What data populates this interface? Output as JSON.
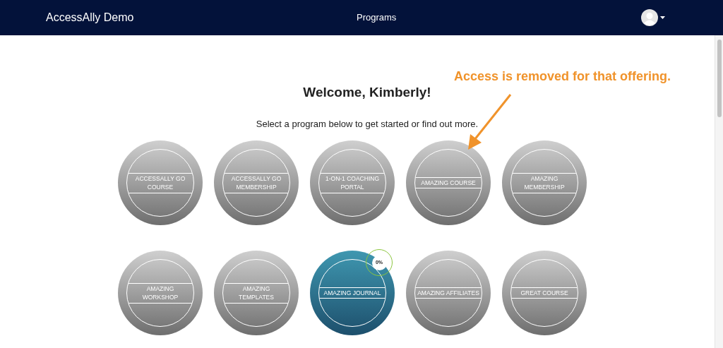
{
  "header": {
    "brand": "AccessAlly Demo",
    "nav": "Programs"
  },
  "welcome": {
    "title": "Welcome, Kimberly!",
    "subtitle": "Select a program below to get started or find out more."
  },
  "annotation": {
    "text": "Access is removed for that offering."
  },
  "programs": [
    {
      "kind": "locked",
      "title": "ACCESSALLY GO COURSE"
    },
    {
      "kind": "locked",
      "title": "ACCESSALLY GO MEMBERSHIP"
    },
    {
      "kind": "locked",
      "title": "1-ON-1 COACHING PORTAL"
    },
    {
      "kind": "locked",
      "title": "AMAZING COURSE"
    },
    {
      "kind": "locked",
      "title": "AMAZING MEMBERSHIP"
    },
    {
      "kind": "locked",
      "title": "AMAZING WORKSHOP"
    },
    {
      "kind": "locked",
      "title": "AMAZING TEMPLATES"
    },
    {
      "kind": "active",
      "title": "AMAZING JOURNAL",
      "progress": "0%"
    },
    {
      "kind": "locked",
      "title": "AMAZING AFFILIATES"
    },
    {
      "kind": "locked",
      "title": "GREAT COURSE"
    }
  ]
}
